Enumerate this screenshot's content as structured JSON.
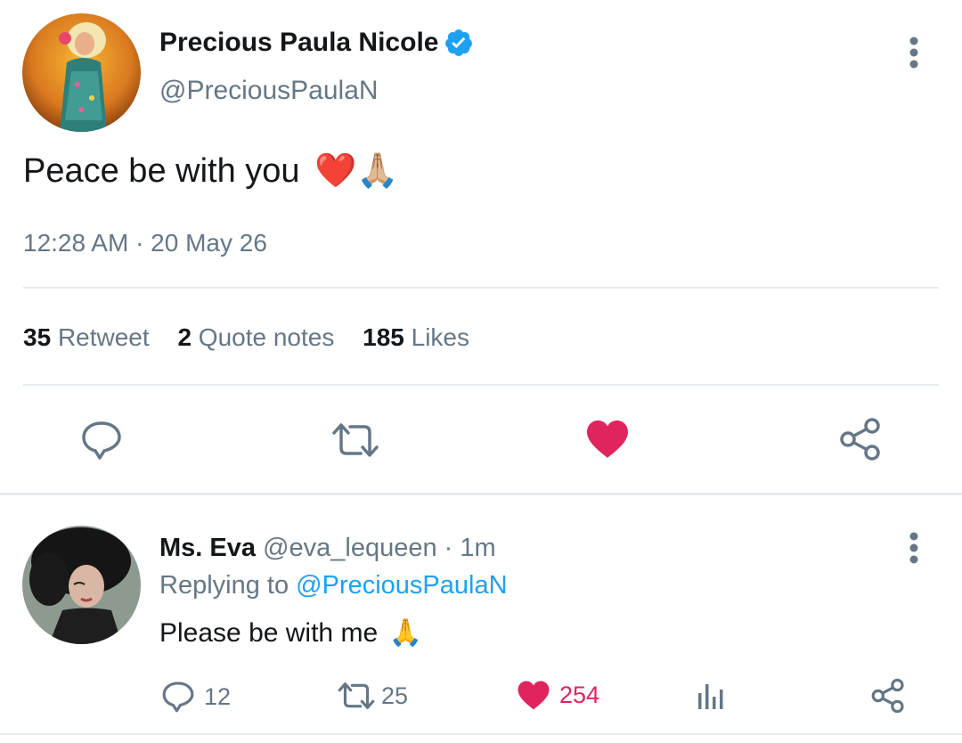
{
  "main_tweet": {
    "author_name": "Precious Paula Nicole",
    "handle": "@PreciousPaulaN",
    "text": "Peace be with you",
    "emoji": "❤️🙏🏼",
    "timestamp": "12:28 AM · 20 May 26",
    "stats": [
      {
        "count": "35",
        "label": "Retweet"
      },
      {
        "count": "2",
        "label": "Quote notes"
      },
      {
        "count": "185",
        "label": "Likes"
      }
    ]
  },
  "reply": {
    "author_name": "Ms. Eva",
    "handle": "@eva_lequeen",
    "separator": "·",
    "time": "1m",
    "replying_prefix": "Replying to",
    "replying_to": "@PreciousPaulaN",
    "text": "Please be with me",
    "emoji": "🙏",
    "reply_count": "12",
    "retweet_count": "25",
    "like_count": "254"
  },
  "colors": {
    "accent": "#1da1f2",
    "like": "#e0245e",
    "muted": "#657786",
    "verified": "#1da1f2"
  },
  "icons": {
    "reply": "comment-icon",
    "retweet": "retweet-icon",
    "like": "heart-icon",
    "share": "share-icon",
    "more": "more-vertical-icon",
    "analytics": "analytics-icon",
    "verified": "verified-badge-icon"
  }
}
